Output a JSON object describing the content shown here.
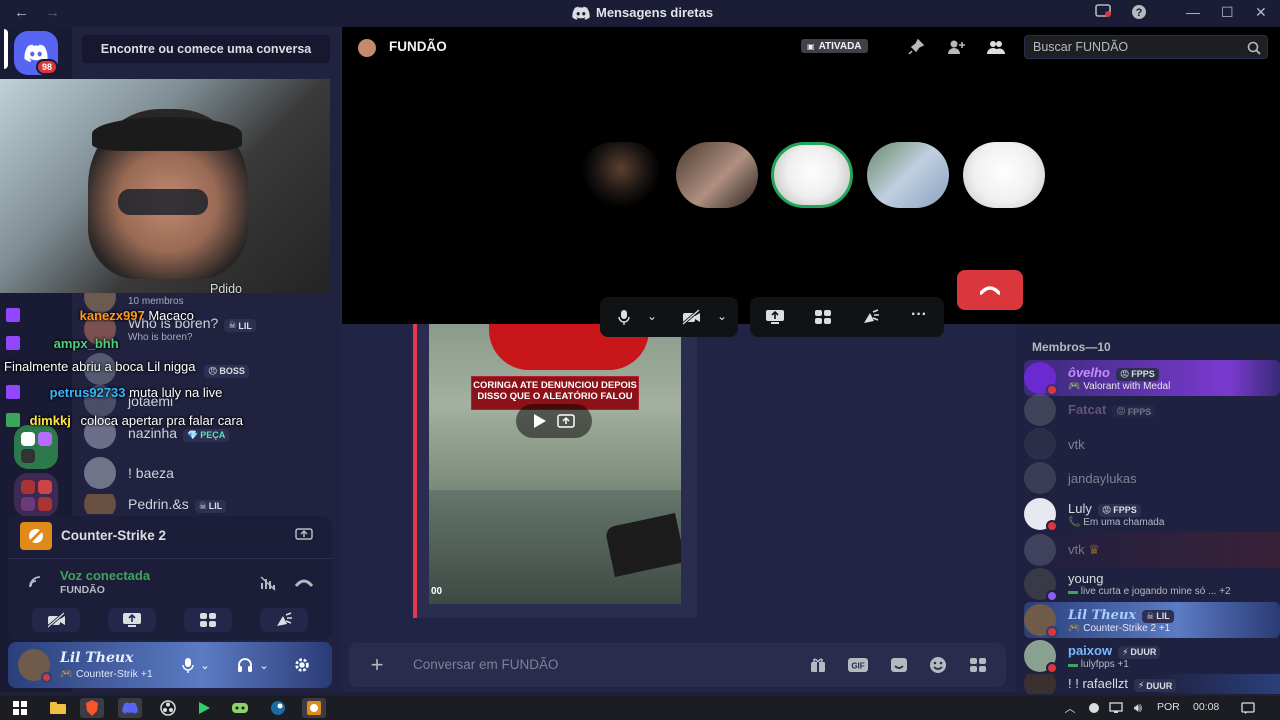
{
  "titlebar": {
    "title": "Mensagens diretas"
  },
  "rail": {
    "dm_badge": "98"
  },
  "dm_panel": {
    "search_label": "Encontre ou comece uma conversa",
    "items": [
      {
        "name": "",
        "sub": "10 membros",
        "tag": ""
      },
      {
        "name": "Who is boren?",
        "sub": "Who is boren?",
        "tag": "LIL"
      },
      {
        "name": "",
        "sub": "",
        "tag": "BOSS"
      },
      {
        "name": "jotaemi",
        "sub": "",
        "tag": ""
      },
      {
        "name": "nazinha",
        "sub": "",
        "tag": "PEÇA"
      },
      {
        "name": "! baeza",
        "sub": "",
        "tag": ""
      },
      {
        "name": "Pedrin.&s",
        "sub": "",
        "tag": "LIL"
      }
    ]
  },
  "game_activity": {
    "game": "Counter-Strike 2"
  },
  "voice": {
    "status": "Voz conectada",
    "channel": "FUNDÃO"
  },
  "user": {
    "name": "Lil Theux",
    "activity": "Counter-Strik +1"
  },
  "stream_overlay": {
    "lines": [
      {
        "user": "kanezx997",
        "text": "Macaco",
        "color": "#ff9a1f"
      },
      {
        "user": "ampx_bhh",
        "text": "",
        "color": "#4bd17a"
      },
      {
        "user": "",
        "text": "Finalmente abriu a boca Lil nigga",
        "color": "#ffffff"
      },
      {
        "user": "petrus92733",
        "text": "muta luly na live",
        "color": "#37b6ff"
      },
      {
        "user": "dimkkj",
        "text": "coloca apertar pra falar cara",
        "color": "#ffe83d"
      }
    ],
    "partial_text": "Pdido"
  },
  "channel": {
    "name": "FUNDÃO",
    "boost_label": "ATIVADA",
    "search_placeholder": "Buscar FUNDÃO",
    "input_placeholder": "Conversar em FUNDÃO"
  },
  "video_embed": {
    "caption_line1": "CORINGA ATE DENUNCIOU DEPOIS",
    "caption_line2": "DISSO QUE O ALEATÓRIO FALOU",
    "time": "00"
  },
  "members": {
    "header": "Membros—10",
    "list": [
      {
        "name": "ôvelho",
        "tag": "FPPS",
        "activity": "Valorant with Medal",
        "color": "#8b5cf6"
      },
      {
        "name": "Fatcat",
        "tag": "FPPS",
        "activity": "",
        "color": "#7a6a9a"
      },
      {
        "name": "vtk",
        "tag": "",
        "activity": "",
        "color": "#6b6f80"
      },
      {
        "name": "jandaylukas",
        "tag": "",
        "activity": "",
        "color": "#6b6f80"
      },
      {
        "name": "Luly",
        "tag": "FPPS",
        "activity": "Em uma chamada",
        "color": "#dbdee1"
      },
      {
        "name": "vtk",
        "tag": "",
        "activity": "",
        "color": "#6b6f80"
      },
      {
        "name": "young",
        "tag": "",
        "activity": "live curta e jogando mine só ... +2",
        "color": "#dbdee1"
      },
      {
        "name": "Lil Theux",
        "tag": "LIL",
        "activity": "Counter-Strike 2 +1",
        "color": "#a6d0ff"
      },
      {
        "name": "paixow",
        "tag": "DUUR",
        "activity": "lulyfpps +1",
        "color": "#a6d0ff"
      },
      {
        "name": "! ! rafaellzt",
        "tag": "DUUR",
        "activity": "",
        "color": "#dbdee1"
      }
    ]
  },
  "taskbar": {
    "lang": "POR",
    "time": "00:08"
  }
}
